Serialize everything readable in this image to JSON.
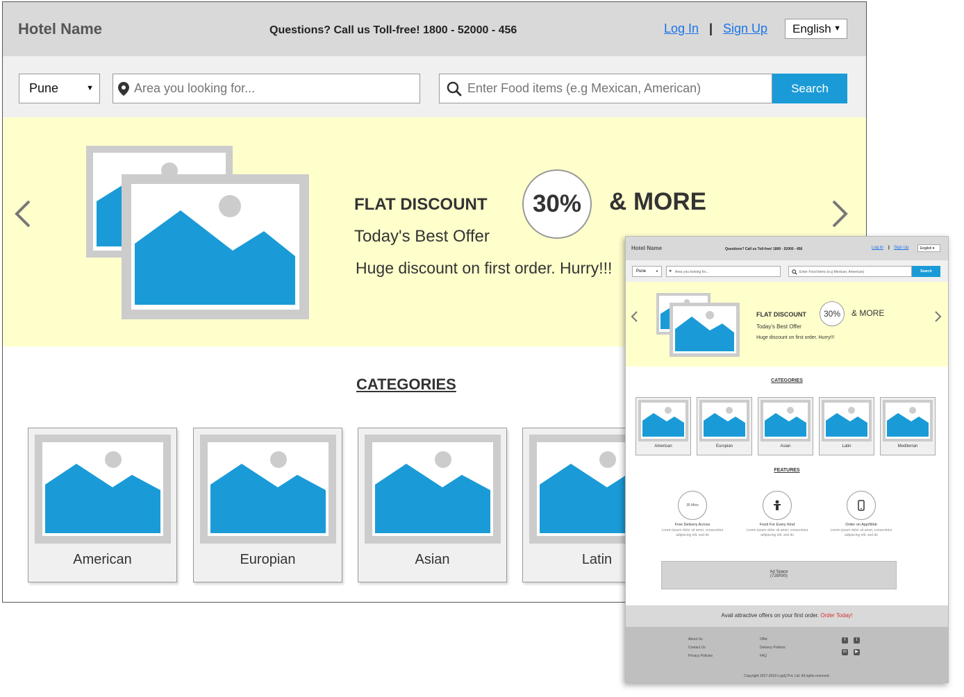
{
  "header": {
    "hotel_name": "Hotel Name",
    "question": "Questions? Call us Toll-free! 1800 - 52000 - 456",
    "login": "Log In",
    "separator": "|",
    "signup": "Sign Up",
    "language": "English"
  },
  "search": {
    "city": "Pune",
    "area_placeholder": "Area you looking for...",
    "food_placeholder": "Enter Food items (e.g Mexican, American)",
    "button": "Search"
  },
  "banner": {
    "flat": "FLAT DISCOUNT",
    "percent": "30%",
    "more": "& MORE",
    "best": "Today's Best Offer",
    "huge": "Huge discount on first order. Hurry!!!"
  },
  "categories": {
    "title": "CATEGORIES",
    "items": [
      "American",
      "Europian",
      "Asian",
      "Latin",
      "Mediterran"
    ]
  },
  "features": {
    "title": "FEATURES",
    "items": [
      {
        "icon_text": "35 Mins",
        "title": "Free Delivery Across",
        "desc": "Lorem ipsum dolor sit amet, consectetur adipiscing elit, sed do"
      },
      {
        "icon_text": "",
        "title": "Food For Every Kind",
        "desc": "Lorem ipsum dolor sit amet, consectetur adipiscing elit, sed do"
      },
      {
        "icon_text": "",
        "title": "Order on App/Web",
        "desc": "Lorem ipsum dolor sit amet, consectetur adipiscing elit, sed do"
      }
    ]
  },
  "ad": {
    "line1": "Ad Space",
    "line2": "(728X90)"
  },
  "offer_bar": {
    "text": "Avail attractive offers on your first order.",
    "link": "Order Today!"
  },
  "footer": {
    "col1": [
      "About Us",
      "Contact Us",
      "Privacy Policies"
    ],
    "col2": [
      "Offer",
      "Delivery Policies",
      "FAQ"
    ],
    "copyright": "Copyright 2017-2018 LogiQ Pvt. Ltd. All rights reserved."
  },
  "colors": {
    "header_bg": "#d9d9d9",
    "banner_bg": "#ffffcc",
    "accent": "#1a9bd7",
    "link": "#1a73e8",
    "offer_link": "#d32f2f"
  },
  "icons": [
    "pin-icon",
    "search-icon",
    "chevron-left-icon",
    "chevron-right-icon",
    "image-placeholder-icon",
    "food-icon",
    "mobile-icon",
    "facebook-icon",
    "twitter-icon",
    "linkedin-icon",
    "youtube-icon"
  ]
}
